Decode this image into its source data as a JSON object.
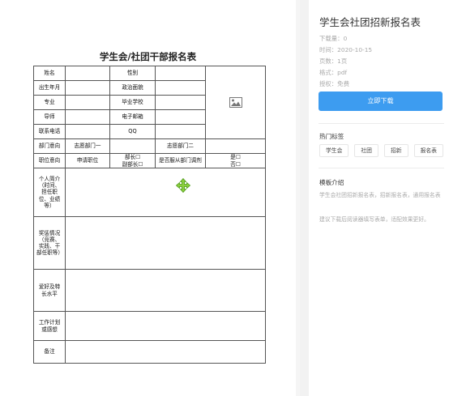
{
  "document": {
    "title": "学生会/社团干部报名表",
    "rows": {
      "name": "姓名",
      "gender": "性别",
      "birth": "出生年月",
      "political": "政治面貌",
      "major": "专业",
      "school": "毕业学校",
      "tutor": "导师",
      "email": "电子邮箱",
      "phone": "联系电话",
      "qq": "QQ",
      "dept_intent": "部门意向",
      "dept1": "志愿部门一",
      "dept2": "志愿部门二",
      "position_intent": "职位意向",
      "apply_position": "申请职位",
      "minister": "部长☐",
      "vice_minister": "副部长☐",
      "obey": "是否服从部门调剂",
      "yes": "是☐",
      "no": "否☐",
      "resume": "个人简介（时间、担任职位、业绩等）",
      "awards": "奖惩情况（竞赛、实践、干部任职等）",
      "hobbies": "爱好及特长水平",
      "plan": "工作计划或感想",
      "notes": "备注"
    }
  },
  "sidebar": {
    "title": "学生会社团招新报名表",
    "meta": {
      "downloads": "下载量：0",
      "date": "时间：2020-10-15",
      "pages": "页数：1页",
      "format": "格式：pdf",
      "license": "授权：免费"
    },
    "download_button": "立即下载",
    "hot_tags_heading": "热门标签",
    "tags": [
      "学生会",
      "社团",
      "招新",
      "报名表"
    ],
    "intro_heading": "模板介绍",
    "intro_text": "学生会社团招新报名表，招新报名表，通用报名表",
    "tip_text": "建议下载后阅读器填写表单，适配效果更好。",
    "accent_color": "#3d9cf0"
  },
  "icons": {
    "photo": "image-placeholder-icon",
    "move": "move-cursor-icon"
  }
}
